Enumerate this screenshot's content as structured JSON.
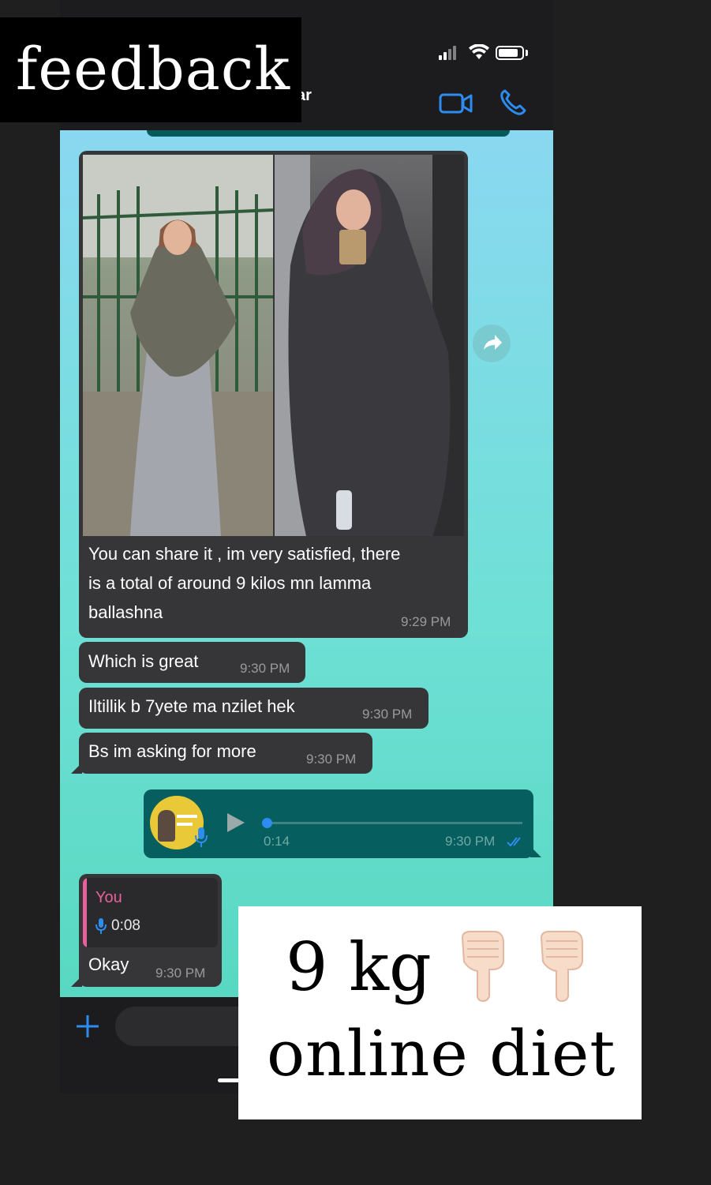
{
  "overlay": {
    "feedback_label": "feedback",
    "promo_line1": "9 kg",
    "promo_line2": "online diet",
    "promo_icons": [
      "backhand-index-pointing-down-icon",
      "backhand-index-pointing-down-icon"
    ]
  },
  "header": {
    "contact_name_fragment": "ar",
    "icons": [
      "video-call-icon",
      "phone-call-icon"
    ]
  },
  "status_bar": {
    "icons": [
      "cellular-signal-icon",
      "wifi-icon",
      "battery-icon"
    ]
  },
  "messages": [
    {
      "type": "image",
      "direction": "incoming",
      "text": "You can share it , im very satisfied, there is a total of around 9 kilos mn lamma ballashna",
      "lines": [
        "You can share it , im very satisfied, there",
        "is a total of around 9 kilos mn lamma",
        "ballashna"
      ],
      "time": "9:29 PM"
    },
    {
      "type": "text",
      "direction": "incoming",
      "text": "Which is great",
      "time": "9:30 PM"
    },
    {
      "type": "text",
      "direction": "incoming",
      "text": "Iltillik b 7yete ma nzilet hek",
      "time": "9:30 PM"
    },
    {
      "type": "text",
      "direction": "incoming",
      "text": "Bs im asking for more",
      "time": "9:30 PM"
    },
    {
      "type": "voice",
      "direction": "outgoing",
      "duration": "0:14",
      "time": "9:30 PM",
      "read": true,
      "progress": 0.0
    },
    {
      "type": "reply",
      "direction": "incoming",
      "quoted_author": "You",
      "quoted_voice_duration": "0:08",
      "text": "Okay",
      "time": "9:30 PM"
    }
  ],
  "colors": {
    "incoming_bubble": "#363638",
    "outgoing_bubble": "#075e5e",
    "accent_blue": "#2d8cf0",
    "reply_pink": "#e8609c",
    "chat_gradient_top": "#8ad8f1",
    "chat_gradient_bottom": "#58d8c1"
  }
}
